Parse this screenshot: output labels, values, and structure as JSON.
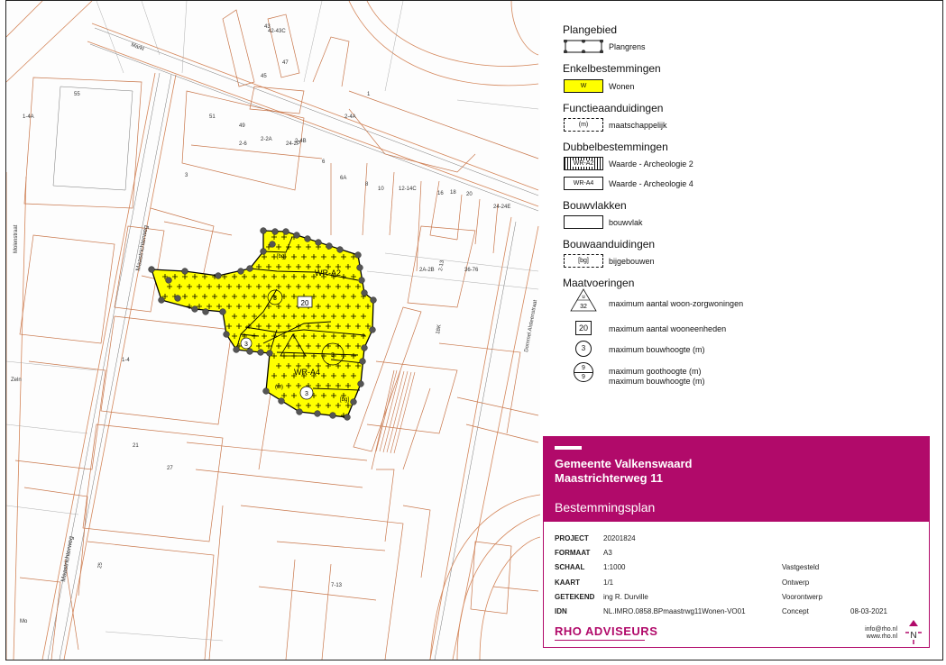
{
  "legend": {
    "plangebied": {
      "heading": "Plangebied",
      "items": [
        {
          "label": "Plangrens"
        }
      ]
    },
    "enkelbestemmingen": {
      "heading": "Enkelbestemmingen",
      "items": [
        {
          "code": "W",
          "label": "Wonen"
        }
      ]
    },
    "functieaanduidingen": {
      "heading": "Functieaanduidingen",
      "items": [
        {
          "code": "(m)",
          "label": "maatschappelijk"
        }
      ]
    },
    "dubbelbestemmingen": {
      "heading": "Dubbelbestemmingen",
      "items": [
        {
          "code": "WR-A2",
          "label": "Waarde - Archeologie 2"
        },
        {
          "code": "WR-A4",
          "label": "Waarde - Archeologie 4"
        }
      ]
    },
    "bouwvlakken": {
      "heading": "Bouwvlakken",
      "items": [
        {
          "label": "bouwvlak"
        }
      ]
    },
    "bouwaanduidingen": {
      "heading": "Bouwaanduidingen",
      "items": [
        {
          "code": "[bg]",
          "label": "bijgebouwen"
        }
      ]
    },
    "maatvoeringen": {
      "heading": "Maatvoeringen",
      "items": [
        {
          "value": "32",
          "label": "maximum aantal woon-zorgwoningen"
        },
        {
          "value": "20",
          "label": "maximum aantal wooneenheden"
        },
        {
          "value": "3",
          "label": "maximum bouwhoogte (m)"
        },
        {
          "value_top": "9",
          "value_bottom": "9",
          "label": "maximum goothoogte (m)",
          "label2": "maximum bouwhoogte (m)"
        }
      ]
    }
  },
  "title_block": {
    "gemeente": "Gemeente Valkenswaard",
    "project_name": "Maastrichterweg 11",
    "plan_type": "Bestemmingsplan",
    "fields": [
      {
        "key": "PROJECT",
        "value": "20201824"
      },
      {
        "key": "FORMAAT",
        "value": "A3"
      },
      {
        "key": "SCHAAL",
        "value": "1:1000"
      },
      {
        "key": "KAART",
        "value": "1/1"
      },
      {
        "key": "GETEKEND",
        "value": "ing R. Durville"
      },
      {
        "key": "IDN",
        "value": "NL.IMRO.0858.BPmaastrwg11Wonen-VO01"
      }
    ],
    "status": [
      "Vastgesteld",
      "Ontwerp",
      "Voorontwerp",
      "Concept"
    ],
    "date": "08-03-2021",
    "logo": "RHO ADVISEURS",
    "email": "info@rho.nl",
    "website": "www.rho.nl",
    "north": "N"
  },
  "map": {
    "colors": {
      "wonen": "#ffff00",
      "topo": "#d4865a",
      "topo_light": "#e8b89a",
      "kadaster": "#777777",
      "boundary": "#000000"
    },
    "street_labels": [
      "Markt",
      "Maastrichterweg",
      "Maastrichterweg",
      "Molenstraat",
      "Dommel Alsteenstraat"
    ],
    "zone_labels": {
      "wr_a2": "WR-A2",
      "wr_a4": "WR-A4",
      "mz": "(m)",
      "bg1": "[bg]",
      "bg2": "[bg]",
      "wz": "20",
      "h1": "3",
      "h2": "3",
      "h3": "3",
      "h4": "3"
    },
    "house_numbers": [
      "55",
      "51",
      "49",
      "45",
      "43",
      "47",
      "3",
      "1",
      "1-4A",
      "2-2A",
      "2-6",
      "2-4B",
      "24-2P",
      "24-24E",
      "6",
      "6A",
      "8",
      "10",
      "12-14C",
      "16",
      "18",
      "20",
      "1-4",
      "21",
      "25",
      "27",
      "2-13",
      "2A-2B",
      "36-76",
      "18K",
      "42-43C",
      "2-4A",
      "7-13",
      "Zeln",
      "Mo"
    ]
  }
}
